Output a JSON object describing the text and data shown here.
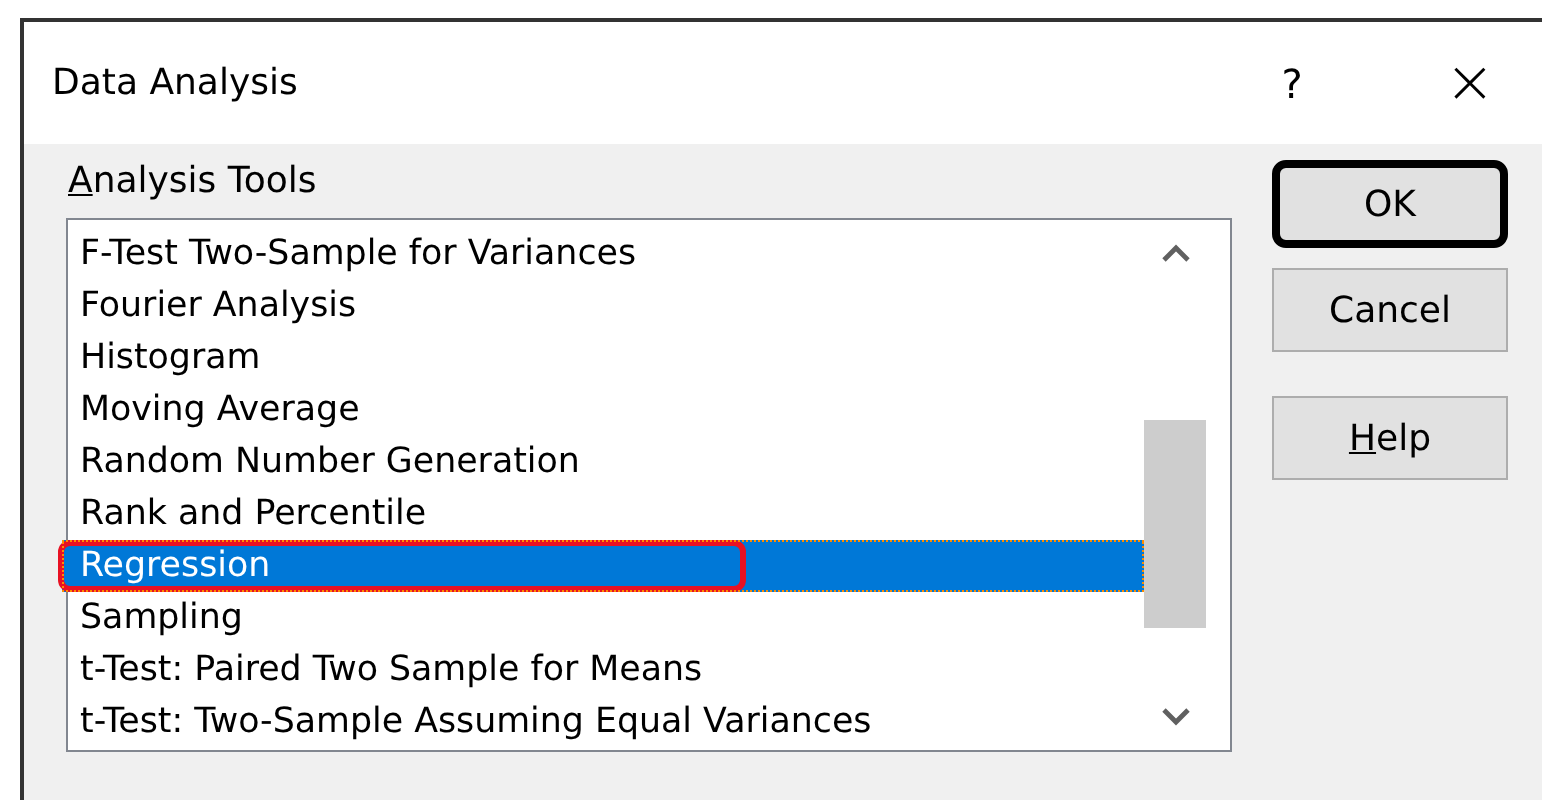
{
  "window": {
    "title": "Data Analysis",
    "help": "?",
    "close": "×"
  },
  "analysis_tools": {
    "label": {
      "mnemonic": "A",
      "rest": "nalysis Tools"
    },
    "items": [
      {
        "label": "F-Test Two-Sample for Variances",
        "selected": false,
        "highlighted": false
      },
      {
        "label": "Fourier Analysis",
        "selected": false,
        "highlighted": false
      },
      {
        "label": "Histogram",
        "selected": false,
        "highlighted": false
      },
      {
        "label": "Moving Average",
        "selected": false,
        "highlighted": false
      },
      {
        "label": "Random Number Generation",
        "selected": false,
        "highlighted": false
      },
      {
        "label": "Rank and Percentile",
        "selected": false,
        "highlighted": false
      },
      {
        "label": "Regression",
        "selected": true,
        "highlighted": true
      },
      {
        "label": "Sampling",
        "selected": false,
        "highlighted": false
      },
      {
        "label": "t-Test: Paired Two Sample for Means",
        "selected": false,
        "highlighted": false
      },
      {
        "label": "t-Test: Two-Sample Assuming Equal Variances",
        "selected": false,
        "highlighted": false
      }
    ]
  },
  "buttons": [
    {
      "rest": "OK",
      "highlighted": true
    },
    {
      "rest": "Cancel",
      "highlighted": false
    },
    {
      "mnemonic": "H",
      "rest": "elp",
      "highlighted": false
    }
  ]
}
